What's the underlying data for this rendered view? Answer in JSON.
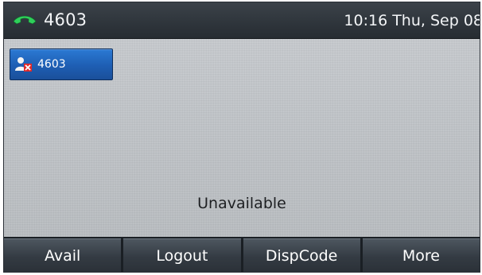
{
  "status_bar": {
    "account": "4603",
    "datetime": "10:16 Thu, Sep 08",
    "icon": "phone-handset-icon",
    "icon_color": "#2fcf5a"
  },
  "line_key": {
    "label": "4603",
    "icon": "user-unavailable-icon",
    "accent": "#1e5eb3"
  },
  "status_message": "Unavailable",
  "softkeys": [
    {
      "label": "Avail"
    },
    {
      "label": "Logout"
    },
    {
      "label": "DispCode"
    },
    {
      "label": "More"
    }
  ]
}
